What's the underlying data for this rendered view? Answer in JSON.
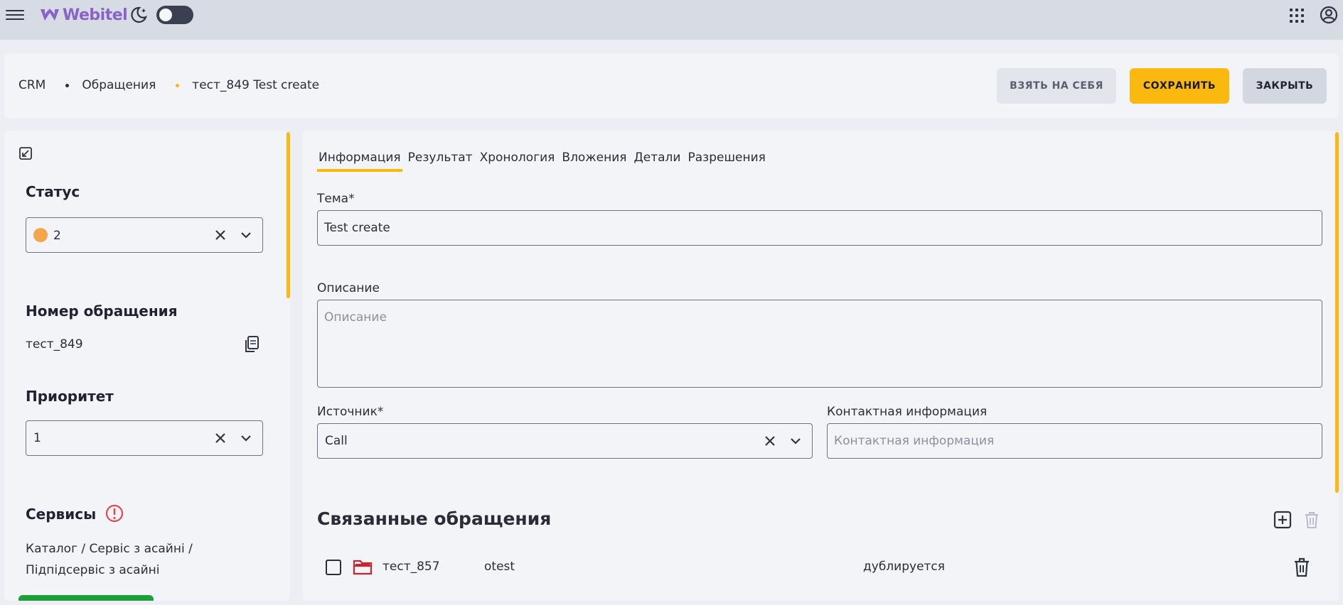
{
  "topbar": {
    "logo_text": "Webitel",
    "icons": [
      "menu-icon",
      "webitel-logo-icon",
      "moon-icon",
      "apps-grid-icon",
      "account-icon"
    ],
    "theme_toggle_on": false
  },
  "breadcrumb": {
    "items": [
      "CRM",
      "Обращения",
      "тест_849 Test create"
    ],
    "dot_colors": [
      "#2a2d38",
      "#fbb80f"
    ]
  },
  "actions": {
    "take_label": "Взять на себя",
    "save_label": "Сохранить",
    "close_label": "Закрыть"
  },
  "sidebar": {
    "status": {
      "title": "Статус",
      "value": "2",
      "dot_color": "#f5a54a"
    },
    "number": {
      "title": "Номер обращения",
      "value": "тест_849"
    },
    "priority": {
      "title": "Приоритет",
      "value": "1"
    },
    "services": {
      "title": "Сервисы",
      "line1": "Каталог / Сервіс з асайні /",
      "line2": "Підпідсервіс з асайні"
    }
  },
  "tabs": [
    "Информация",
    "Результат",
    "Хронология",
    "Вложения",
    "Детали",
    "Разрешения"
  ],
  "form": {
    "subject": {
      "label": "Тема*",
      "value": "Test create"
    },
    "description": {
      "label": "Описание",
      "placeholder": "Описание"
    },
    "source": {
      "label": "Источник*",
      "value": "Call"
    },
    "contact": {
      "label": "Контактная информация",
      "placeholder": "Контактная информация"
    }
  },
  "related": {
    "title": "Связанные обращения",
    "rows": [
      {
        "id": "тест_857",
        "author": "otest",
        "relation": "дублируется"
      }
    ]
  },
  "colors": {
    "accent": "#fbb80f",
    "topbar": "#d7dbe4",
    "panel": "#f3f4f8",
    "warning": "#e5484d",
    "folder": "#c8262e",
    "logo": "#8a63c8"
  }
}
